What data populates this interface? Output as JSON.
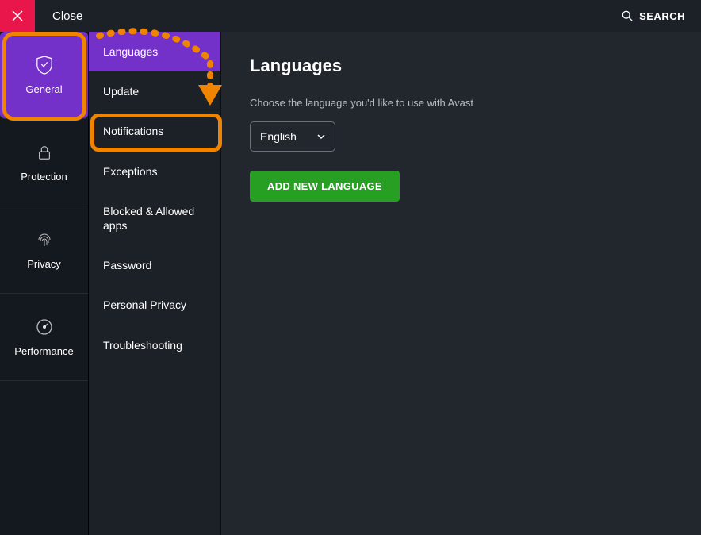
{
  "topbar": {
    "close_label": "Close",
    "search_label": "SEARCH"
  },
  "leftnav": {
    "items": [
      {
        "label": "General"
      },
      {
        "label": "Protection"
      },
      {
        "label": "Privacy"
      },
      {
        "label": "Performance"
      }
    ]
  },
  "subnav": {
    "items": [
      {
        "label": "Languages"
      },
      {
        "label": "Update"
      },
      {
        "label": "Notifications"
      },
      {
        "label": "Exceptions"
      },
      {
        "label": "Blocked & Allowed apps"
      },
      {
        "label": "Password"
      },
      {
        "label": "Personal Privacy"
      },
      {
        "label": "Troubleshooting"
      }
    ]
  },
  "main": {
    "title": "Languages",
    "description": "Choose the language you'd like to use with Avast",
    "selected_language": "English",
    "add_button_label": "ADD NEW LANGUAGE"
  },
  "colors": {
    "accent_purple": "#7431c9",
    "close_red": "#e9164b",
    "button_green": "#279f22",
    "annotation_orange": "#f08400"
  }
}
